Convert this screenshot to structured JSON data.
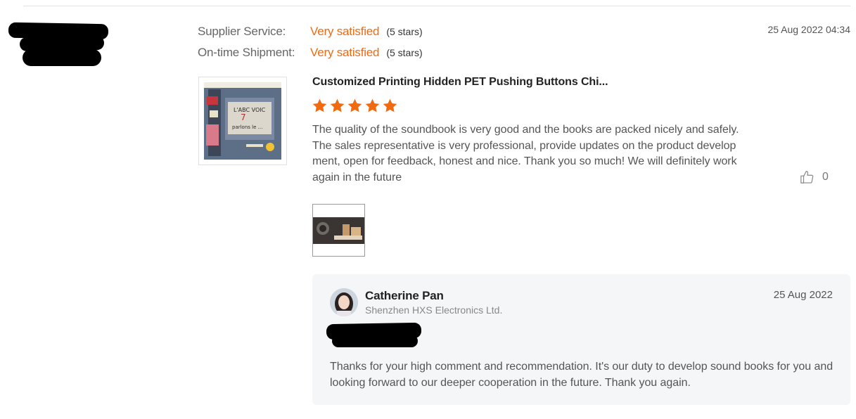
{
  "review": {
    "ratings": [
      {
        "label": "Supplier Service:",
        "value": "Very satisfied",
        "stars": "(5 stars)"
      },
      {
        "label": "On-time Shipment:",
        "value": "Very satisfied",
        "stars": "(5 stars)"
      }
    ],
    "date": "25 Aug 2022 04:34",
    "product_title": "Customized Printing Hidden PET Pushing Buttons Chi...",
    "star_rating": 5,
    "star_color": "#f26a10",
    "comment": "The quality of the soundbook is very good and the books are packed nicely and safely. The sales representative is very professional, provide updates on the product development, open for feedback, honest and nice. Thank you so much! We will definitely work again in the future ",
    "like_count": "0",
    "like_icon": "thumbs-up-icon"
  },
  "reply": {
    "name": "Catherine Pan",
    "company": "Shenzhen HXS Electronics Ltd.",
    "date": "25 Aug 2022",
    "text": "Thanks for your high comment and recommendation. It's our duty to develop sound books for you and looking forward to our deeper cooperation in the future. Thank you again."
  },
  "colors": {
    "accent": "#f26a10",
    "reply_bg": "#f5f6f7"
  }
}
